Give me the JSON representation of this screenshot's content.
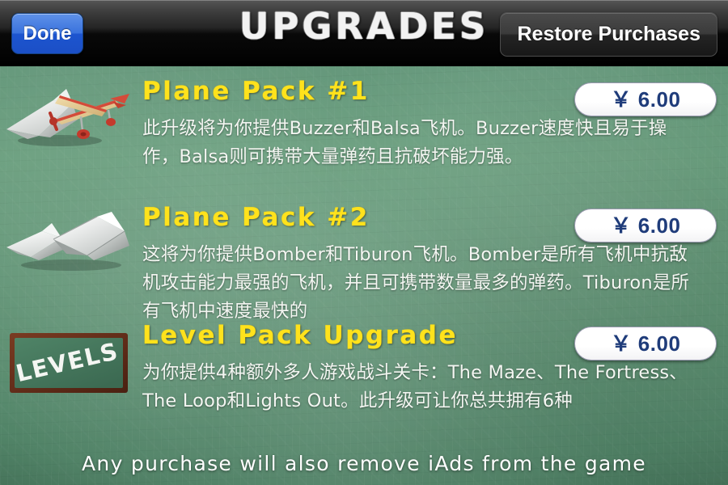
{
  "navbar": {
    "done_label": "Done",
    "title": "UPGRADES",
    "restore_label": "Restore Purchases"
  },
  "items": [
    {
      "id": "plane-pack-1",
      "title": "Plane Pack #1",
      "description": "此升级将为你提供Buzzer和Balsa飞机。Buzzer速度快且易于操作，Balsa则可携带大量弹药且抗破坏能力强。",
      "price": "￥ 6.00",
      "icon": "paper-plane-and-balsa-plane-icon"
    },
    {
      "id": "plane-pack-2",
      "title": "Plane Pack #2",
      "description": "这将为你提供Bomber和Tiburon飞机。Bomber是所有飞机中抗敌机攻击能力最强的飞机，并且可携带数量最多的弹药。Tiburon是所有飞机中速度最快的",
      "price": "￥ 6.00",
      "icon": "two-paper-planes-icon"
    },
    {
      "id": "level-pack-upgrade",
      "title": "Level Pack Upgrade",
      "description": "为你提供4种额外多人游戏战斗关卡：The Maze、The Fortress、The Loop和Lights Out。此升级可让你总共拥有6种",
      "price": "￥ 6.00",
      "icon": "levels-chalkboard-icon",
      "icon_label": "LEVELS"
    }
  ],
  "footer": {
    "note": "Any purchase will also remove iAds from the game"
  },
  "colors": {
    "board_green": "#5c9071",
    "title_yellow": "#ffe21c",
    "price_blue": "#1f3c7a",
    "done_blue": "#3a72dd",
    "chalk_white": "#f4f6f2"
  }
}
